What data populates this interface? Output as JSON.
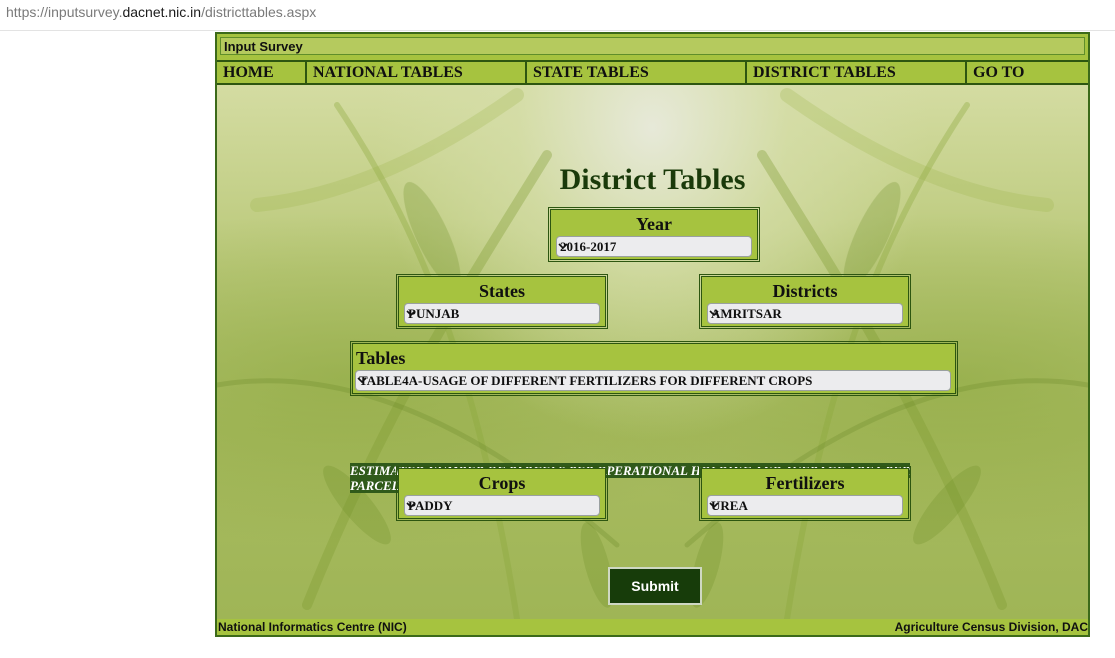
{
  "browser": {
    "url_prefix": "https://inputsurvey.",
    "url_domain": "dacnet.nic.in",
    "url_path": "/districttables.aspx"
  },
  "app": {
    "title": "Input Survey"
  },
  "nav": {
    "items": [
      "HOME",
      "NATIONAL TABLES",
      "STATE TABLES",
      "DISTRICT TABLES",
      "GO TO"
    ]
  },
  "page": {
    "heading": "District Tables"
  },
  "form": {
    "year": {
      "label": "Year",
      "value": "2016-2017"
    },
    "states": {
      "label": "States",
      "value": "PUNJAB"
    },
    "districts": {
      "label": "Districts",
      "value": "AMRITSAR"
    },
    "tables": {
      "label": "Tables",
      "value": "TABLE4A-USAGE OF DIFFERENT FERTILIZERS FOR DIFFERENT CROPS"
    },
    "note": "ESTIMATED NUMBER OF PARCELS PER OPERATIONAL HOLDING AND AVERAGE AREA PER PARCEL BY SIZE GROUPS",
    "crops": {
      "label": "Crops",
      "value": "PADDY"
    },
    "fertilizers": {
      "label": "Fertilizers",
      "value": "UREA"
    },
    "submit_label": "Submit"
  },
  "footer": {
    "left": "National Informatics Centre (NIC)",
    "right": "Agriculture Census Division, DAC"
  },
  "colors": {
    "accent": "#a6c33f",
    "border": "#2d5610",
    "heading": "#1a3a0a",
    "button": "#173c0a"
  },
  "icons": {
    "select_arrow": "chevron-down-icon"
  }
}
